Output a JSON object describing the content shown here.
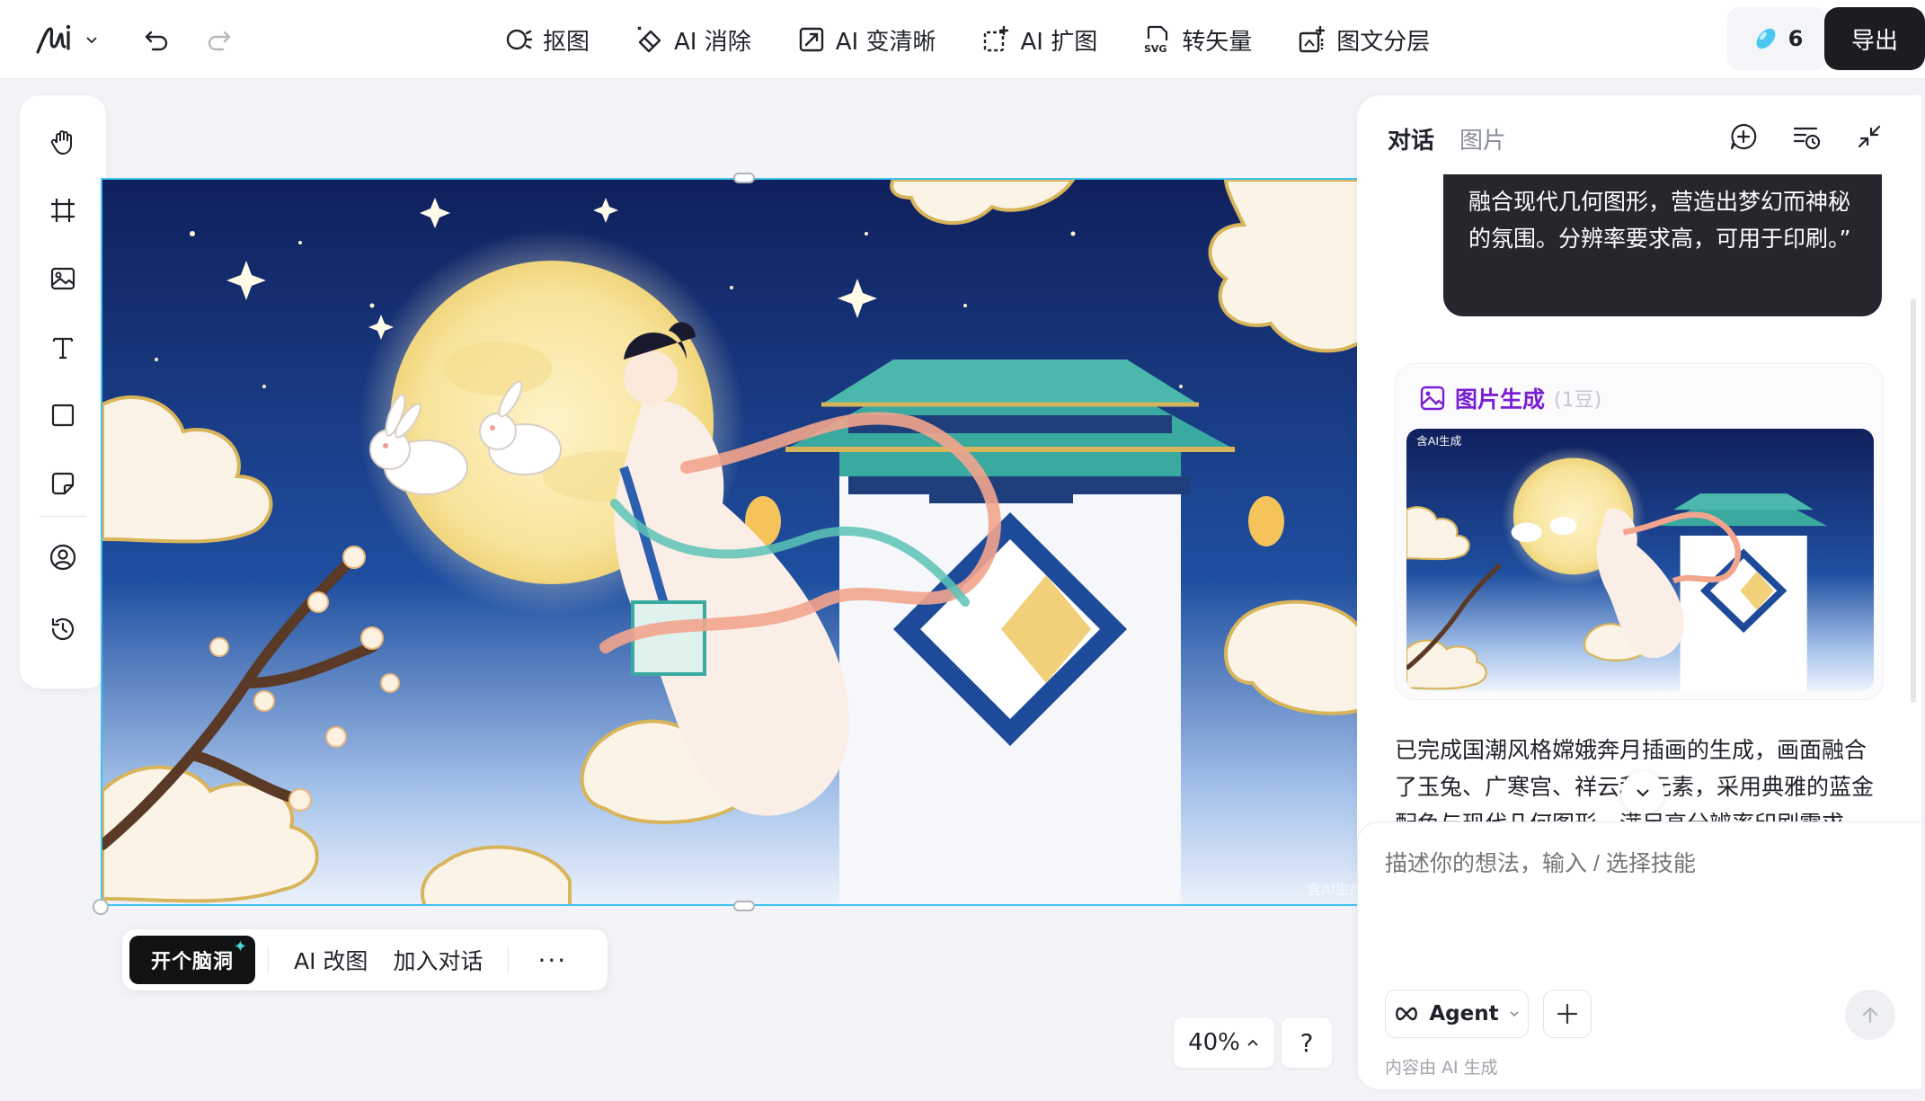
{
  "toolbar": {
    "tools": [
      {
        "label": "抠图",
        "icon": "cutout-icon"
      },
      {
        "label": "AI 消除",
        "icon": "eraser-icon"
      },
      {
        "label": "AI 变清晰",
        "icon": "enhance-icon"
      },
      {
        "label": "AI 扩图",
        "icon": "expand-icon"
      },
      {
        "label": "转矢量",
        "icon": "svg-icon"
      },
      {
        "label": "图文分层",
        "icon": "layers-icon"
      }
    ],
    "credits": "6",
    "export_label": "导出"
  },
  "canvas": {
    "watermark": "含AI生成"
  },
  "context_bar": {
    "brain_label": "开个脑洞",
    "edit_label": "AI 改图",
    "add_chat_label": "加入对话",
    "more_label": "···"
  },
  "zoom": {
    "level": "40%",
    "help": "?"
  },
  "panel": {
    "tabs": [
      "对话",
      "图片"
    ],
    "user_message": "融合现代几何图形，营造出梦幻而神秘的氛围。分辨率要求高，可用于印刷。”",
    "gen_title": "图片生成",
    "gen_cost": "(1豆)",
    "gen_watermark": "含AI生成",
    "ai_reply": "已完成国潮风格嫦娥奔月插画的生成，画面融合了玉兔、广寒宫、祥云和      元素，采用典雅的蓝金配色与现代几何图形，满足高分辨率印刷需求。",
    "input_placeholder": "描述你的想法，输入 / 选择技能",
    "agent_label": "Agent",
    "disclaimer": "内容由 AI 生成"
  },
  "colors": {
    "accent": "#3fc3f0",
    "gen_title": "#7a1fd6",
    "dark": "#1c1d21"
  }
}
